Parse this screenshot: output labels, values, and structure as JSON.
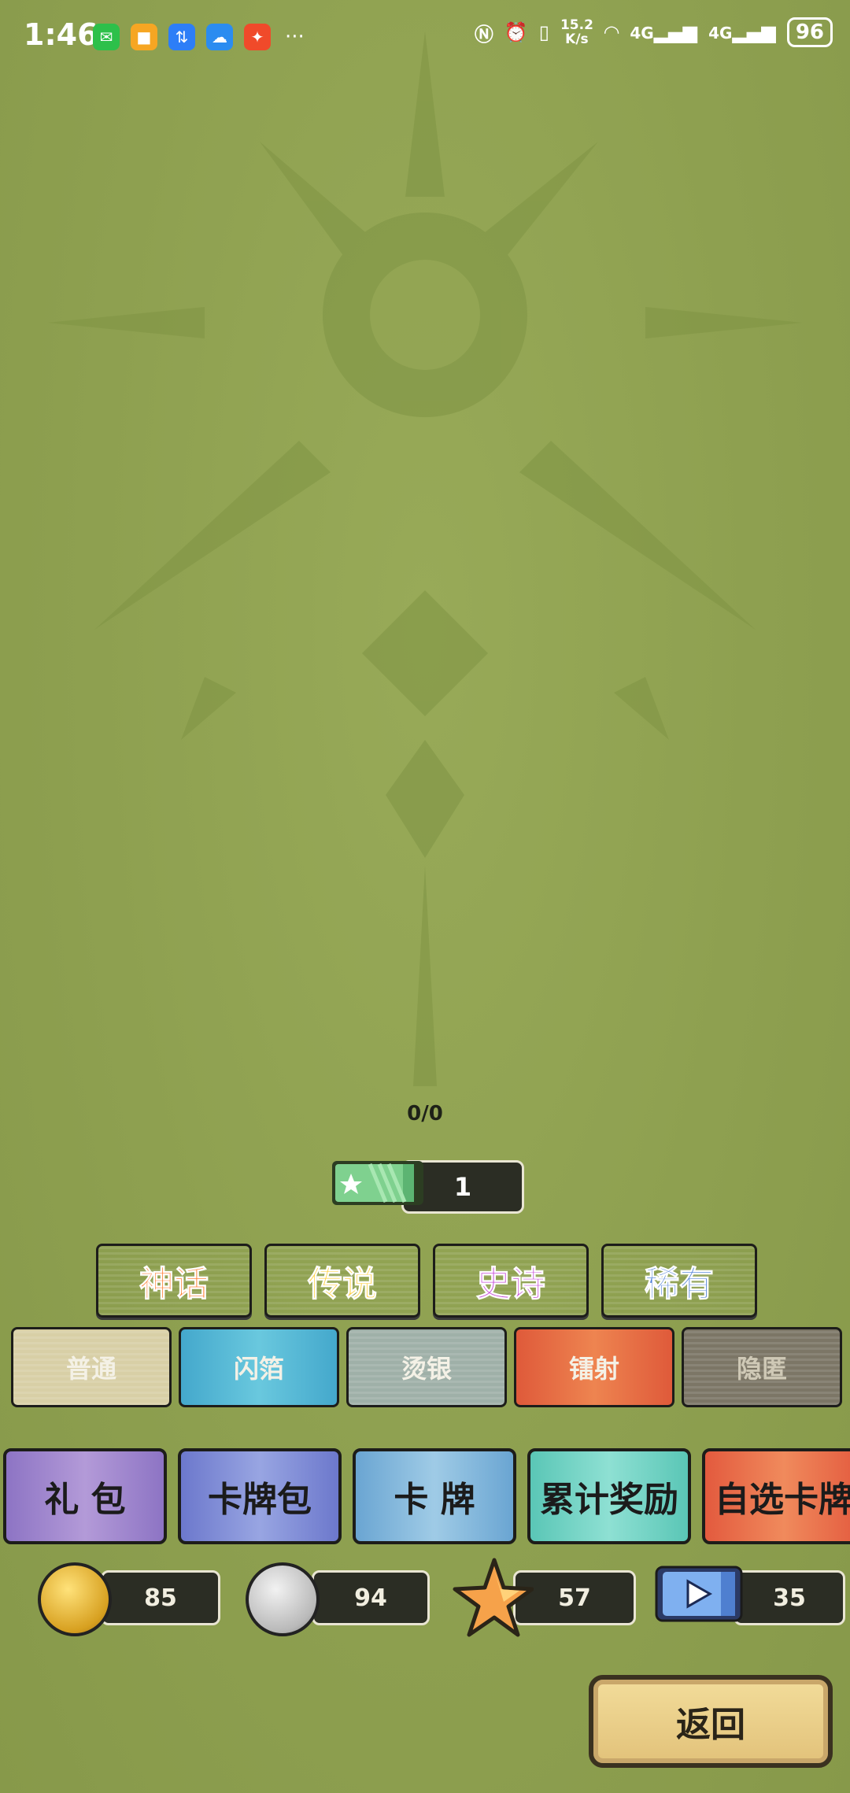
{
  "status_bar": {
    "time": "1:46",
    "more": "···",
    "speed_value": "15.2",
    "speed_unit": "K/s",
    "network1": "4G",
    "network2": "4G",
    "battery": "96",
    "app_icons": [
      "wechat-icon",
      "orange-app-icon",
      "transfer-app-icon",
      "cloud-app-icon",
      "red-app-icon"
    ]
  },
  "progress": {
    "text": "0/0"
  },
  "ticket": {
    "count": "1"
  },
  "rarity_tabs": [
    {
      "label": "神话",
      "color": "#ff7a2a"
    },
    {
      "label": "传说",
      "color": "#ffcf3a"
    },
    {
      "label": "史诗",
      "color": "#c64bd8"
    },
    {
      "label": "稀有",
      "color": "#4d7fd6"
    }
  ],
  "finish_tabs": [
    {
      "label": "普通",
      "bg": "#d8cfa6"
    },
    {
      "label": "闪箔",
      "bg": "#55b8d3"
    },
    {
      "label": "烫银",
      "bg": "#9fb0a8"
    },
    {
      "label": "镭射",
      "bg": "#e5613f"
    },
    {
      "label": "隐匿",
      "bg": "#7c7666"
    }
  ],
  "categories": [
    {
      "label": "礼 包",
      "bg": "#9b83c9"
    },
    {
      "label": "卡牌包",
      "bg": "#7d86d2"
    },
    {
      "label": "卡 牌",
      "bg": "#83b6d8"
    },
    {
      "label": "累计奖励",
      "bg": "#6fd1c1"
    },
    {
      "label": "自选卡牌",
      "bg": "#ea6b4c"
    }
  ],
  "currencies": {
    "gold_coin": "85",
    "silver_coin": "94",
    "star": "57",
    "video_ticket": "35"
  },
  "back_label": "返回"
}
